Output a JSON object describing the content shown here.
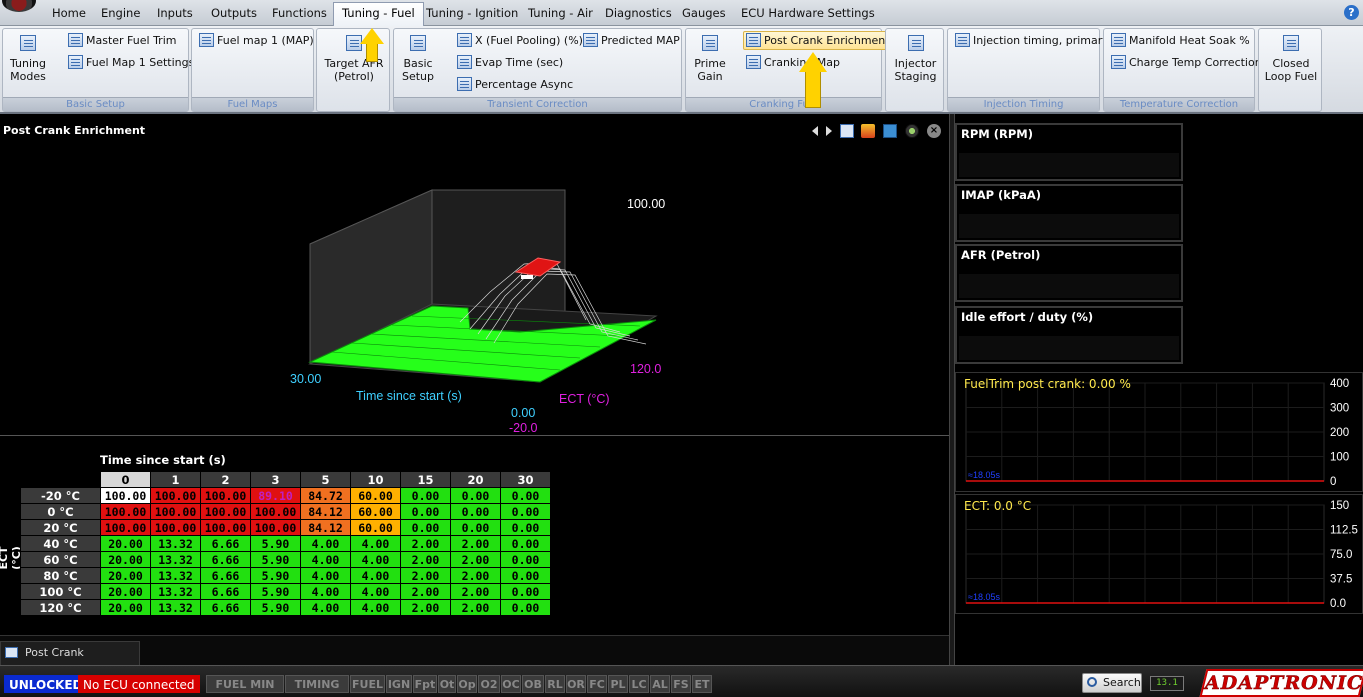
{
  "menu": {
    "items": [
      "Home",
      "Engine",
      "Inputs",
      "Outputs",
      "Functions",
      "Tuning - Fuel",
      "Tuning - Ignition",
      "Tuning - Air",
      "Diagnostics",
      "Gauges",
      "ECU Hardware Settings"
    ],
    "active": "Tuning - Fuel",
    "help": "?"
  },
  "ribbon": {
    "tuning_modes": "Tuning Modes",
    "master_fuel_trim": "Master Fuel Trim",
    "fuel_map1_settings": "Fuel Map 1 Settings",
    "group_basic_setup": "Basic Setup",
    "fuel_map1": "Fuel map 1 (MAP)",
    "group_fuel_maps": "Fuel Maps",
    "target_afr": "Target AFR (Petrol)",
    "basic_setup": "Basic Setup",
    "x_fuel_pooling": "X (Fuel Pooling) (%)",
    "evap_time": "Evap Time (sec)",
    "percentage_async": "Percentage Async",
    "predicted_map": "Predicted MAP",
    "group_transient": "Transient Correction",
    "prime_gain": "Prime Gain",
    "post_crank_enrichment": "Post Crank Enrichment",
    "cranking_map": "Cranking Map",
    "group_cranking": "Cranking Fuel",
    "injector_staging": "Injector Staging",
    "injection_timing_primary": "Injection timing, primary",
    "group_injection_timing": "Injection Timing",
    "manifold_heat_soak": "Manifold Heat Soak %",
    "charge_temp_correction": "Charge Temp Correction",
    "group_temperature": "Temperature Correction",
    "closed_loop_fuel": "Closed Loop Fuel"
  },
  "panel": {
    "title": "Post Crank Enrichment",
    "tab_label": "Post Crank Enrichment"
  },
  "graph3d": {
    "z_max": "100.00",
    "z_min": "0.00",
    "x_min": "30.00",
    "x_label": "Time since start (s)",
    "y_max": "120.0",
    "y_min": "-20.0",
    "y_label": "ECT (°C)"
  },
  "table": {
    "x_title": "Time since start (s)",
    "y_title": "ECT (°C)",
    "columns": [
      "0",
      "1",
      "2",
      "3",
      "5",
      "10",
      "15",
      "20",
      "30"
    ],
    "selected_column": 0,
    "rows": [
      {
        "label": "-20 °C",
        "values": [
          "100.00",
          "100.00",
          "100.00",
          "89.10",
          "84.72",
          "60.00",
          "0.00",
          "0.00",
          "0.00"
        ]
      },
      {
        "label": "0 °C",
        "values": [
          "100.00",
          "100.00",
          "100.00",
          "100.00",
          "84.12",
          "60.00",
          "0.00",
          "0.00",
          "0.00"
        ]
      },
      {
        "label": "20 °C",
        "values": [
          "100.00",
          "100.00",
          "100.00",
          "100.00",
          "84.12",
          "60.00",
          "0.00",
          "0.00",
          "0.00"
        ]
      },
      {
        "label": "40 °C",
        "values": [
          "20.00",
          "13.32",
          "6.66",
          "5.90",
          "4.00",
          "4.00",
          "2.00",
          "2.00",
          "0.00"
        ]
      },
      {
        "label": "60 °C",
        "values": [
          "20.00",
          "13.32",
          "6.66",
          "5.90",
          "4.00",
          "4.00",
          "2.00",
          "2.00",
          "0.00"
        ]
      },
      {
        "label": "80 °C",
        "values": [
          "20.00",
          "13.32",
          "6.66",
          "5.90",
          "4.00",
          "4.00",
          "2.00",
          "2.00",
          "0.00"
        ]
      },
      {
        "label": "100 °C",
        "values": [
          "20.00",
          "13.32",
          "6.66",
          "5.90",
          "4.00",
          "4.00",
          "2.00",
          "2.00",
          "0.00"
        ]
      },
      {
        "label": "120 °C",
        "values": [
          "20.00",
          "13.32",
          "6.66",
          "5.90",
          "4.00",
          "4.00",
          "2.00",
          "2.00",
          "0.00"
        ]
      }
    ],
    "colors": {
      "white": "#ffffff",
      "red": "#e01010",
      "magenta_text": "#c020c0",
      "orange": "#f07020",
      "amber": "#ffb000",
      "green": "#22e010"
    }
  },
  "gauges": [
    {
      "label": "RPM (RPM)"
    },
    {
      "label": "IMAP  (kPaA)"
    },
    {
      "label": "AFR (Petrol)"
    },
    {
      "label": "Idle effort / duty (%)"
    }
  ],
  "charts": [
    {
      "title": "FuelTrim post crank:  0.00 %",
      "ticks": [
        "400",
        "300",
        "200",
        "100",
        "0"
      ],
      "time_label": "≈18.05s"
    },
    {
      "title": "ECT:  0.0 °C",
      "ticks": [
        "150",
        "112.5",
        "75.0",
        "37.5",
        "0.0"
      ],
      "time_label": "≈18.05s"
    }
  ],
  "chart_data": [
    {
      "type": "line",
      "title": "FuelTrim post crank:  0.00 %",
      "ylim": [
        0,
        400
      ],
      "series": [
        {
          "values": [
            0,
            0
          ]
        }
      ]
    },
    {
      "type": "line",
      "title": "ECT:  0.0 °C",
      "ylim": [
        0,
        150
      ],
      "series": [
        {
          "values": [
            0,
            0
          ]
        }
      ]
    }
  ],
  "status": {
    "unlocked": "UNLOCKED",
    "no_ecu": "No ECU connected",
    "flags": [
      "FUEL MIN PW",
      "TIMING",
      "FUEL",
      "IGN",
      "Fpt",
      "Ot",
      "Op",
      "O2",
      "OC",
      "OB",
      "RL",
      "OR",
      "FC",
      "PL",
      "LC",
      "AL",
      "FS",
      "ET"
    ],
    "search": "Search",
    "battery": "13.1",
    "brand": "ADAPTRONIC"
  }
}
